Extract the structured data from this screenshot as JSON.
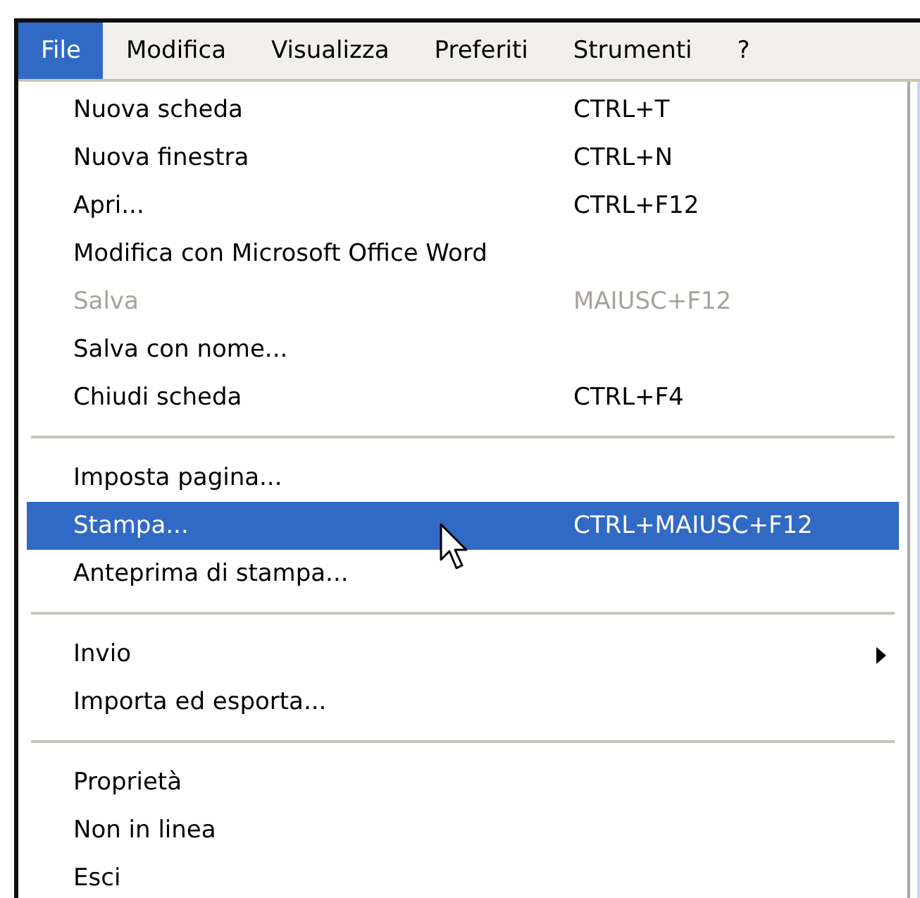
{
  "menubar": [
    {
      "label": "File",
      "selected": true
    },
    {
      "label": "Modifica",
      "selected": false
    },
    {
      "label": "Visualizza",
      "selected": false
    },
    {
      "label": "Preferiti",
      "selected": false
    },
    {
      "label": "Strumenti",
      "selected": false
    },
    {
      "label": "?",
      "selected": false
    }
  ],
  "menu": {
    "groups": [
      [
        {
          "label": "Nuova scheda",
          "shortcut": "CTRL+T",
          "disabled": false,
          "selected": false,
          "submenu": false
        },
        {
          "label": "Nuova finestra",
          "shortcut": "CTRL+N",
          "disabled": false,
          "selected": false,
          "submenu": false
        },
        {
          "label": "Apri...",
          "shortcut": "CTRL+F12",
          "disabled": false,
          "selected": false,
          "submenu": false
        },
        {
          "label": "Modifica con Microsoft Office Word",
          "disabled": false,
          "selected": false,
          "submenu": false
        },
        {
          "label": "Salva",
          "shortcut": "MAIUSC+F12",
          "disabled": true,
          "selected": false,
          "submenu": false
        },
        {
          "label": "Salva con nome...",
          "disabled": false,
          "selected": false,
          "submenu": false
        },
        {
          "label": "Chiudi scheda",
          "shortcut": "CTRL+F4",
          "disabled": false,
          "selected": false,
          "submenu": false
        }
      ],
      [
        {
          "label": "Imposta pagina...",
          "disabled": false,
          "selected": false,
          "submenu": false
        },
        {
          "label": "Stampa...",
          "shortcut": "CTRL+MAIUSC+F12",
          "disabled": false,
          "selected": true,
          "submenu": false
        },
        {
          "label": "Anteprima di stampa...",
          "disabled": false,
          "selected": false,
          "submenu": false
        }
      ],
      [
        {
          "label": "Invio",
          "disabled": false,
          "selected": false,
          "submenu": true
        },
        {
          "label": "Importa ed esporta...",
          "disabled": false,
          "selected": false,
          "submenu": false
        }
      ],
      [
        {
          "label": "Proprietà",
          "disabled": false,
          "selected": false,
          "submenu": false
        },
        {
          "label": "Non in linea",
          "disabled": false,
          "selected": false,
          "submenu": false
        },
        {
          "label": "Esci",
          "disabled": false,
          "selected": false,
          "submenu": false
        }
      ]
    ]
  }
}
